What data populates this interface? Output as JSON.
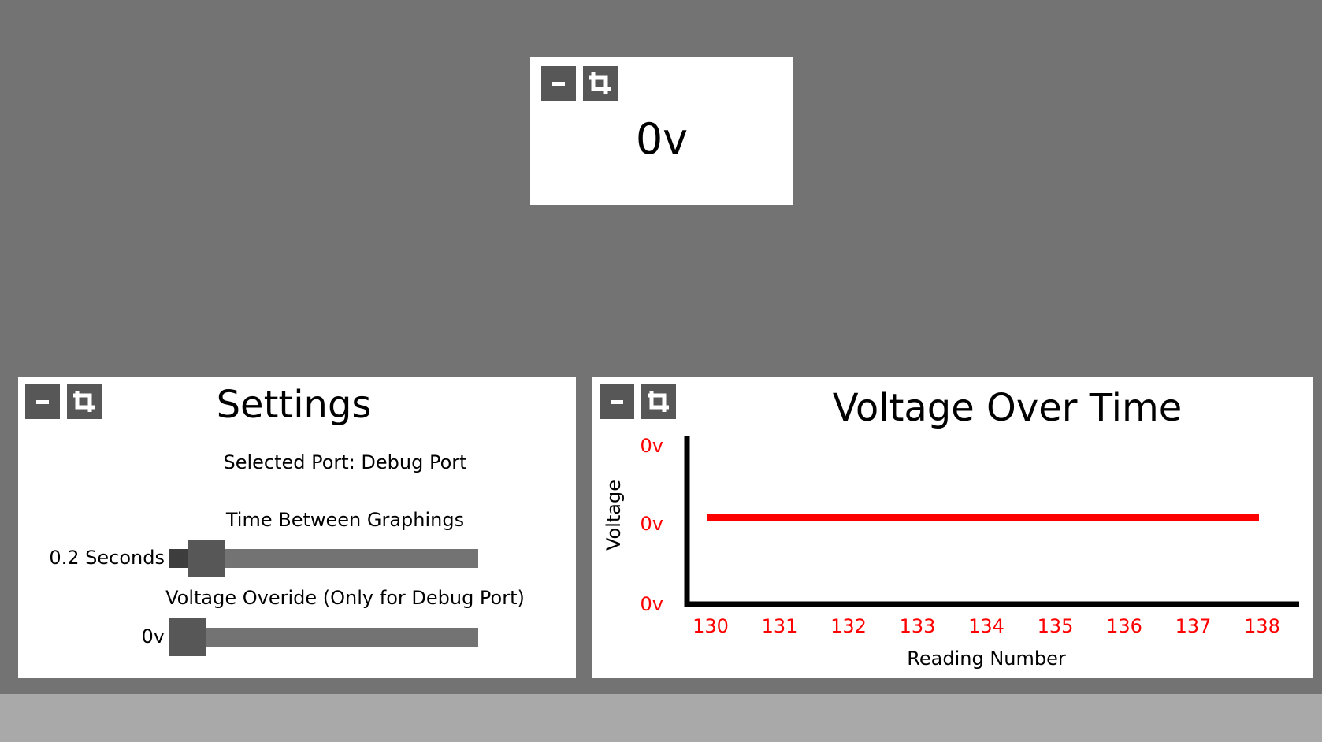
{
  "readout": {
    "value": "0v",
    "minimize_label": "–",
    "crop_icon": "crop-icon"
  },
  "settings": {
    "title": "Settings",
    "minimize_label": "–",
    "crop_icon": "crop-icon",
    "selected_port": "Selected Port: Debug Port",
    "time_label": "Time Between Graphings",
    "time_value": "0.2 Seconds",
    "time_level": 0.07,
    "override_label": "Voltage Overide (Only for Debug Port)",
    "override_value": "0v",
    "override_level": 0.0
  },
  "chart": {
    "minimize_label": "–",
    "crop_icon": "crop-icon"
  },
  "chart_data": {
    "type": "line",
    "title": "Voltage Over Time",
    "xlabel": "Reading Number",
    "ylabel": "Voltage",
    "x": [
      130,
      131,
      132,
      133,
      134,
      135,
      136,
      137,
      138
    ],
    "series": [
      {
        "values": [
          0,
          0,
          0,
          0,
          0,
          0,
          0,
          0,
          0
        ],
        "color": "#ff0000"
      }
    ],
    "y_tick_labels": [
      "0v",
      "0v",
      "0v"
    ],
    "grid": false,
    "tick_color": "#ff0000"
  }
}
